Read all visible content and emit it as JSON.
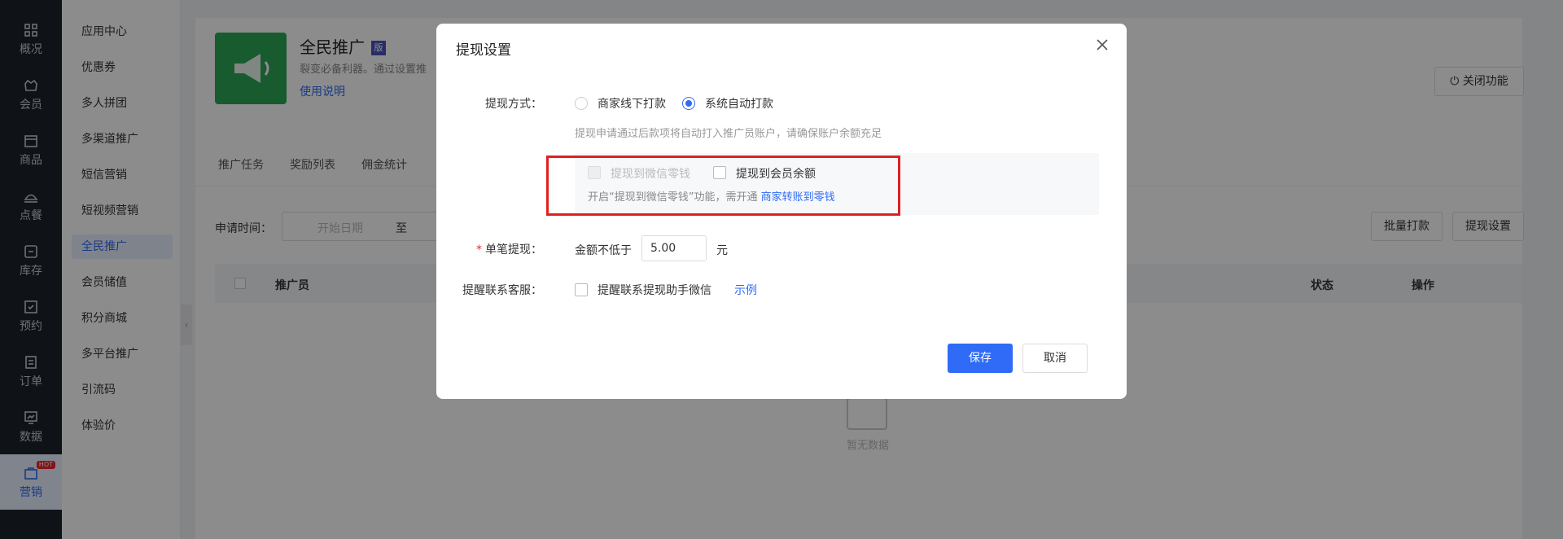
{
  "nav": {
    "items": [
      {
        "label": "概况",
        "icon": "dashboard-icon"
      },
      {
        "label": "会员",
        "icon": "member-icon"
      },
      {
        "label": "商品",
        "icon": "goods-icon"
      },
      {
        "label": "点餐",
        "icon": "dish-icon"
      },
      {
        "label": "库存",
        "icon": "inventory-icon"
      },
      {
        "label": "预约",
        "icon": "booking-icon"
      },
      {
        "label": "订单",
        "icon": "order-icon"
      },
      {
        "label": "数据",
        "icon": "data-icon"
      },
      {
        "label": "营销",
        "icon": "marketing-icon",
        "badge": "HOT"
      }
    ]
  },
  "submenu": {
    "items": [
      "应用中心",
      "优惠券",
      "多人拼团",
      "多渠道推广",
      "短信营销",
      "短视频营销",
      "全民推广",
      "会员储值",
      "积分商城",
      "多平台推广",
      "引流码",
      "体验价"
    ],
    "active": "全民推广"
  },
  "page": {
    "title": "全民推广",
    "title_badge": "版",
    "description": "裂变必备利器。通过设置推",
    "help_link": "使用说明",
    "close_feature": "关闭功能",
    "tabs": [
      "推广任务",
      "奖励列表",
      "佣金统计"
    ],
    "filter_label": "申请时间：",
    "date_placeholder": "开始日期",
    "date_separator": "至",
    "batch_pay": "批量打款",
    "withdraw_settings": "提现设置",
    "table_headers": [
      "推广员",
      "状态",
      "操作"
    ],
    "empty_text": "暂无数据"
  },
  "dialog": {
    "title": "提现设置",
    "method_label": "提现方式：",
    "method_options": [
      "商家线下打款",
      "系统自动打款"
    ],
    "method_selected": 1,
    "method_hint": "提现申请通过后款项将自动打入推广员账户，请确保账户余额充足",
    "target_options": [
      "提现到微信零钱",
      "提现到会员余额"
    ],
    "target_hint_prefix": "开启“提现到微信零钱”功能，需开通",
    "target_hint_link": "商家转账到零钱",
    "single_label": "单笔提现：",
    "single_prefix": "金额不低于",
    "single_value": "5.00",
    "single_unit": "元",
    "remind_label": "提醒联系客服：",
    "remind_option": "提醒联系提现助手微信",
    "remind_example": "示例",
    "save": "保存",
    "cancel": "取消"
  },
  "colors": {
    "primary": "#2f6bf6",
    "highlight_border": "#e02020",
    "nav_bg": "#1d2129"
  }
}
